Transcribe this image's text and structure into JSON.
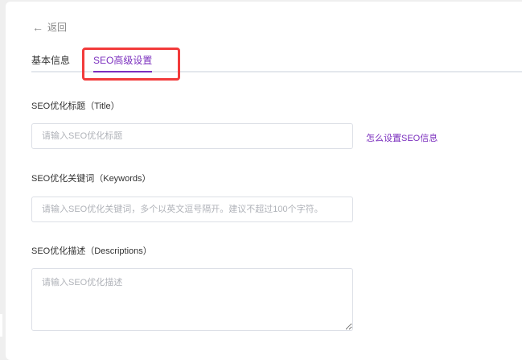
{
  "nav": {
    "back_label": "返回"
  },
  "tabs": [
    {
      "label": "基本信息",
      "active": false
    },
    {
      "label": "SEO高级设置",
      "active": true
    }
  ],
  "form": {
    "title": {
      "label": "SEO优化标题（Title）",
      "placeholder": "请输入SEO优化标题",
      "value": ""
    },
    "keywords": {
      "label": "SEO优化关键词（Keywords）",
      "placeholder": "请输入SEO优化关键词，多个以英文逗号隔开。建议不超过100个字符。",
      "value": ""
    },
    "descriptions": {
      "label": "SEO优化描述（Descriptions）",
      "placeholder": "请输入SEO优化描述",
      "value": ""
    },
    "help_link": "怎么设置SEO信息"
  },
  "colors": {
    "accent": "#7b2fbe",
    "highlight": "#f23b3b"
  }
}
